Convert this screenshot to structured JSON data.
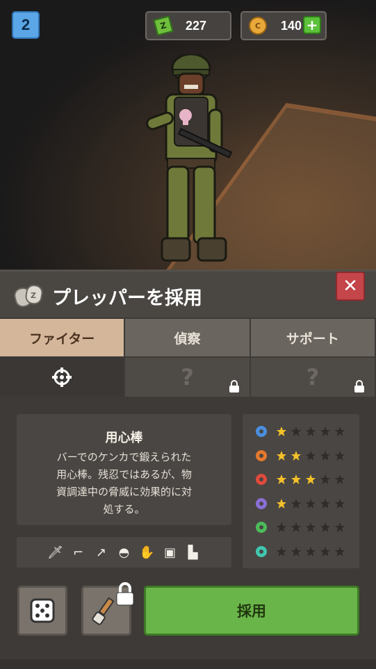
{
  "top_bar": {
    "level": "2",
    "cash": "227",
    "coins": "140"
  },
  "panel": {
    "title": "プレッパーを採用",
    "tabs": [
      {
        "label": "ファイター",
        "active": true
      },
      {
        "label": "偵察",
        "active": false
      },
      {
        "label": "サポート",
        "active": false
      }
    ],
    "sub_slots": [
      {
        "icon": "crosshair-icon",
        "locked": false
      },
      {
        "label": "?",
        "locked": true
      },
      {
        "label": "?",
        "locked": true
      }
    ],
    "character": {
      "name": "用心棒",
      "description": "バーでのケンカで鍛えられた\n用心棒。残忍ではあるが、物\n資調達中の脅威に効果的に対\n処する。"
    },
    "equipment_icons": [
      "knife-icon",
      "rifle-icon",
      "spear-icon",
      "helmet-icon",
      "glove-icon",
      "vest-icon",
      "boots-icon"
    ],
    "stats": [
      {
        "icon": "gear-icon",
        "color": "#4a8fe0",
        "stars": 1
      },
      {
        "icon": "gear-orange-icon",
        "color": "#e5782c",
        "stars": 2
      },
      {
        "icon": "sword-icon",
        "color": "#e04a3c",
        "stars": 3
      },
      {
        "icon": "ghost-icon",
        "color": "#8a6fd6",
        "stars": 1
      },
      {
        "icon": "plant-icon",
        "color": "#4cbc5a",
        "stars": 0
      },
      {
        "icon": "key-icon",
        "color": "#3fc7b0",
        "stars": 0
      }
    ],
    "max_stars": 5,
    "hire_label": "採用"
  }
}
